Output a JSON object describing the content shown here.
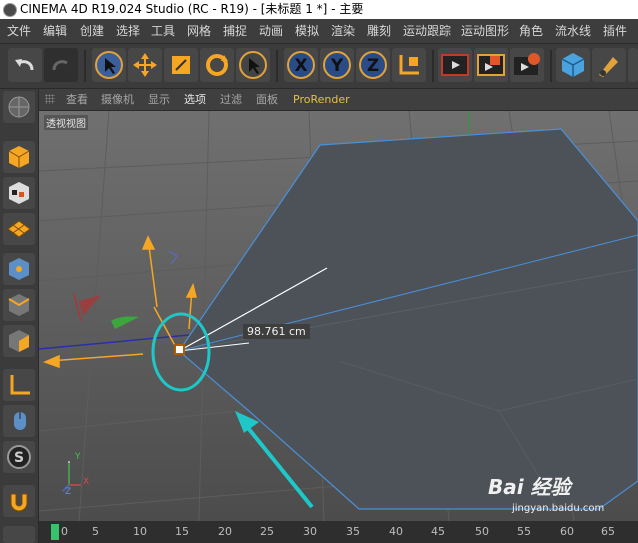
{
  "title": "CINEMA 4D R19.024 Studio (RC - R19) - [未标题 1 *] - 主要",
  "menu": [
    "文件",
    "编辑",
    "创建",
    "选择",
    "工具",
    "网格",
    "捕捉",
    "动画",
    "模拟",
    "渲染",
    "雕刻",
    "运动跟踪",
    "运动图形",
    "角色",
    "流水线",
    "插件"
  ],
  "viewport_menu": [
    "查看",
    "摄像机",
    "显示",
    "选项",
    "过滤",
    "面板",
    "ProRender"
  ],
  "viewport_label": "透视视图",
  "measure_label": "98.761 cm",
  "axis_labels": {
    "y": "Y",
    "x": "X",
    "z": "Z"
  },
  "timeline_ticks": [
    "0",
    "5",
    "10",
    "15",
    "20",
    "25",
    "30",
    "35",
    "40",
    "45",
    "50",
    "55",
    "60",
    "65"
  ],
  "watermark": "Bai 经验",
  "watermark_url": "jingyan.baidu.com",
  "toolbar_letters": [
    "X",
    "Y",
    "Z"
  ],
  "colors": {
    "accent_orange": "#f5a623",
    "cyan_highlight": "#1ec8c8",
    "plane": "#4d5259",
    "edge_blue": "#4a90d9"
  }
}
